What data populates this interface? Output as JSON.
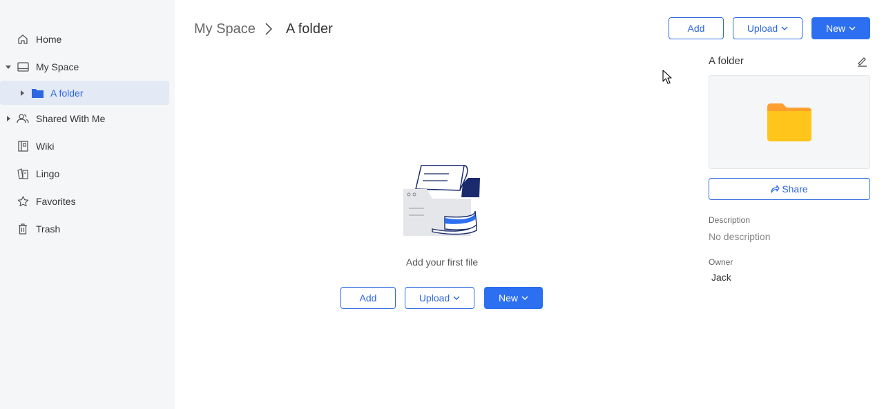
{
  "sidebar": {
    "items": [
      {
        "label": "Home",
        "icon": "home-icon"
      },
      {
        "label": "My Space",
        "icon": "my-space-icon"
      },
      {
        "label": "A folder",
        "icon": "folder-icon"
      },
      {
        "label": "Shared With Me",
        "icon": "shared-users-icon"
      },
      {
        "label": "Wiki",
        "icon": "wiki-icon"
      },
      {
        "label": "Lingo",
        "icon": "lingo-icon"
      },
      {
        "label": "Favorites",
        "icon": "star-icon"
      },
      {
        "label": "Trash",
        "icon": "trash-icon"
      }
    ]
  },
  "breadcrumb": {
    "root": "My Space",
    "current": "A folder"
  },
  "toolbar": {
    "add_label": "Add",
    "upload_label": "Upload",
    "new_label": "New"
  },
  "empty_state": {
    "message": "Add your first file",
    "add_label": "Add",
    "upload_label": "Upload",
    "new_label": "New"
  },
  "details": {
    "title": "A folder",
    "share_label": "Share",
    "description_label": "Description",
    "description_value": "No description",
    "owner_label": "Owner",
    "owner_value": "Jack"
  },
  "colors": {
    "accent": "#2c6ff0",
    "sidebar_bg": "#f5f6f7",
    "active_bg": "#e3e9f5",
    "folder_yellow": "#ffc51a",
    "folder_tab": "#ff9f2e"
  }
}
